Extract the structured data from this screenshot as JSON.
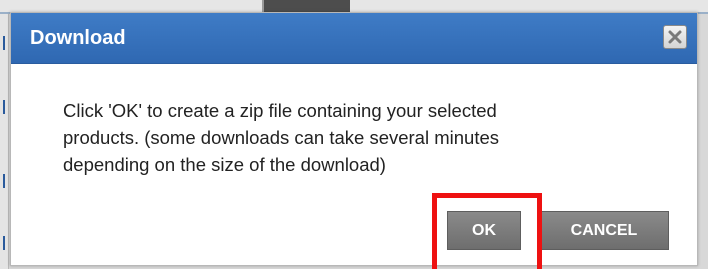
{
  "dialog": {
    "title": "Download",
    "close_icon": "close-icon",
    "message_lines": [
      "Click 'OK' to create a zip file containing your selected",
      "products. (some downloads can take several minutes",
      "depending on the size of the download)"
    ],
    "ok_label": "OK",
    "cancel_label": "CANCEL"
  },
  "colors": {
    "titlebar": "#3473bd",
    "button": "#7a7a7a",
    "highlight": "#ee1111"
  }
}
